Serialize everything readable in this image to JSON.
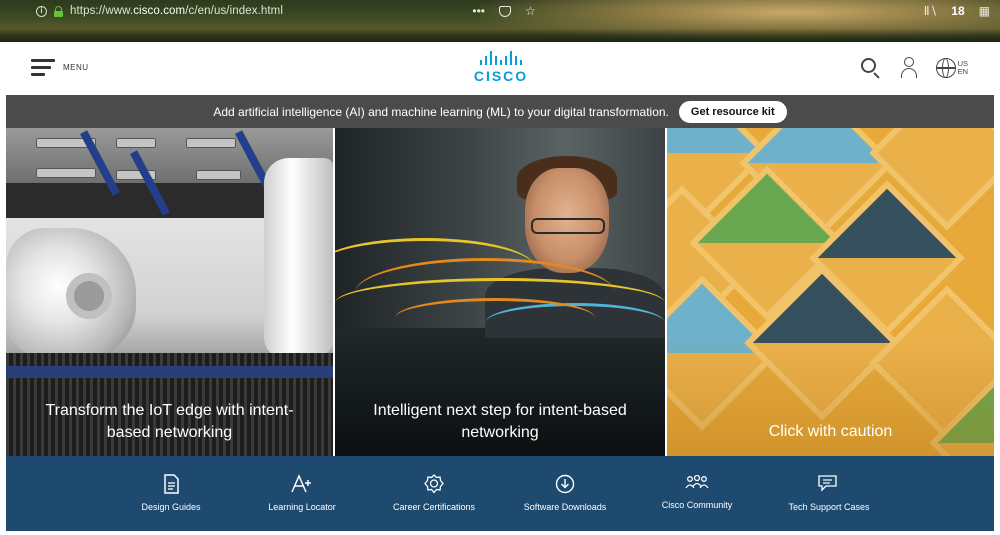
{
  "browser": {
    "url_prefix": "https://www.",
    "url_domain": "cisco.com",
    "url_path": "/c/en/us/index.html",
    "toolbar_count": "18",
    "icons": [
      "info-icon",
      "lock-icon",
      "more-icon",
      "pocket-icon",
      "bookmark-star-icon",
      "library-icon",
      "extension-icon"
    ]
  },
  "header": {
    "menu_label": "MENU",
    "logo_text": "CISCO",
    "locale_country": "US",
    "locale_language": "EN",
    "icons": [
      "hamburger-icon",
      "search-icon",
      "user-icon",
      "globe-icon"
    ]
  },
  "banner": {
    "text": "Add artificial intelligence (AI) and machine learning (ML) to your digital transformation.",
    "button_label": "Get resource kit"
  },
  "hero": {
    "tiles": [
      {
        "caption": "Transform the IoT edge with intent-based networking"
      },
      {
        "caption": "Intelligent next step for intent-based networking"
      },
      {
        "caption": "Click with caution"
      }
    ]
  },
  "quicklinks": {
    "items": [
      {
        "label": "Design Guides",
        "icon": "document-icon"
      },
      {
        "label": "Learning Locator",
        "icon": "a-plus-icon"
      },
      {
        "label": "Career Certifications",
        "icon": "certification-badge-icon"
      },
      {
        "label": "Software Downloads",
        "icon": "download-icon"
      },
      {
        "label": "Cisco Community",
        "icon": "community-icon"
      },
      {
        "label": "Tech Support Cases",
        "icon": "chat-icon"
      }
    ]
  },
  "colors": {
    "brand_blue": "#049fd9",
    "banner_bg": "#4b4b4b",
    "footer_bg": "#1d4a6e"
  }
}
